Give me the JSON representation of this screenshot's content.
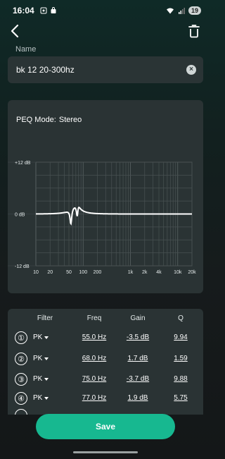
{
  "status_bar": {
    "time": "16:04",
    "battery": "19"
  },
  "preset": {
    "name_label": "Name",
    "name_value": "bk 12 20-300hz"
  },
  "eq": {
    "mode_label": "PEQ Mode:",
    "mode_value": "Stereo",
    "y_labels": [
      "+12 dB",
      "0 dB",
      "-12 dB"
    ],
    "x_labels": [
      "10",
      "20",
      "50",
      "100",
      "200",
      "1k",
      "2k",
      "4k",
      "10k",
      "20k"
    ],
    "y_range_db": [
      -12,
      12
    ],
    "x_range_hz": [
      10,
      20000
    ],
    "x_scale": "log",
    "grid": true
  },
  "filters": {
    "headers": {
      "filter": "Filter",
      "freq": "Freq",
      "gain": "Gain",
      "q": "Q"
    },
    "rows": [
      {
        "num": "①",
        "type": "PK",
        "freq": "55.0 Hz",
        "gain": "-3.5 dB",
        "q": "9.94"
      },
      {
        "num": "②",
        "type": "PK",
        "freq": "68.0 Hz",
        "gain": "1.7 dB",
        "q": "1.59"
      },
      {
        "num": "③",
        "type": "PK",
        "freq": "75.0 Hz",
        "gain": "-3.7 dB",
        "q": "9.88"
      },
      {
        "num": "④",
        "type": "PK",
        "freq": "77.0 Hz",
        "gain": "1.9 dB",
        "q": "5.75"
      }
    ]
  },
  "actions": {
    "save_label": "Save"
  },
  "colors": {
    "accent": "#17b890",
    "card": "#2a3334",
    "field": "#2a3435"
  },
  "icons": {
    "back": "chevron-left-icon",
    "delete": "trash-icon",
    "clear": "close-circle-icon",
    "caret": "caret-down-icon"
  }
}
